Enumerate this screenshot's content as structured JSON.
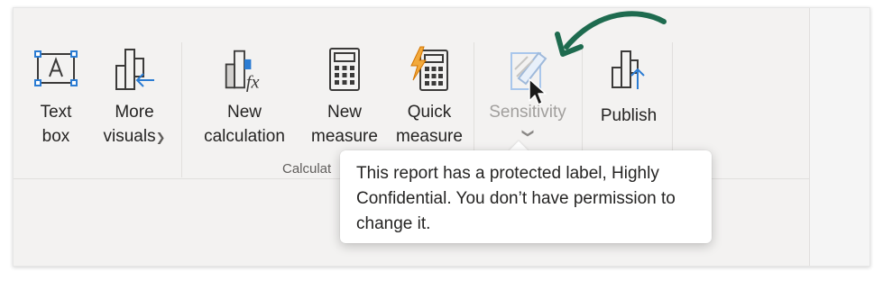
{
  "ribbon": {
    "buttons": {
      "text_box": "Text\nbox",
      "more_visuals": "More\nvisuals",
      "new_calculation": "New\ncalculation",
      "new_measure": "New\nmeasure",
      "quick_measure": "Quick\nmeasure",
      "sensitivity": "Sensitivity",
      "publish": "Publish"
    },
    "group_label": "Calculat"
  },
  "tooltip": {
    "text": "This report has a protected label, Highly Confidential. You don’t have permission to change it."
  },
  "icons": {
    "text_box": "text-box-icon",
    "more_visuals": "more-visuals-icon",
    "new_calculation": "new-calculation-icon",
    "new_measure": "calculator-icon",
    "quick_measure": "quick-measure-icon",
    "sensitivity": "sensitivity-icon",
    "publish": "publish-icon"
  },
  "colors": {
    "accent_blue": "#2b7cd3",
    "callout_arrow": "#1e6b4f",
    "lightning": "#f2a93b",
    "disabled_text": "#a19f9d"
  }
}
